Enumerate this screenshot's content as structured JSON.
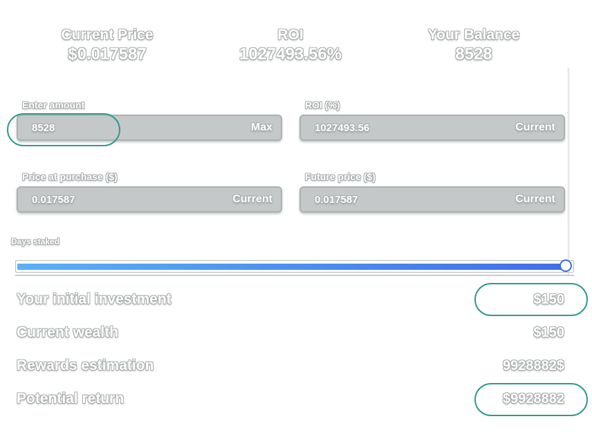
{
  "stats": {
    "current_price": {
      "label": "Current Price",
      "value": "$0.017587"
    },
    "roi": {
      "label": "ROI",
      "value": "1027493.56%"
    },
    "balance": {
      "label": "Your Balance",
      "value": "8528"
    }
  },
  "fields": {
    "amount": {
      "label": "Enter amount",
      "value": "8528",
      "button": "Max"
    },
    "roi": {
      "label": "ROI (%)",
      "value": "1027493.56",
      "button": "Current"
    },
    "purchase_price": {
      "label": "Price at purchase ($)",
      "value": "0.017587",
      "button": "Current"
    },
    "future_price": {
      "label": "Future price ($)",
      "value": "0.017587",
      "button": "Current"
    }
  },
  "slider": {
    "label": "Days staked",
    "fraction": 1.0
  },
  "summary": [
    {
      "label": "Your initial investment",
      "value": "$150"
    },
    {
      "label": "Current wealth",
      "value": "$150"
    },
    {
      "label": "Rewards estimation",
      "value": "9928882$"
    },
    {
      "label": "Potential return",
      "value": "$9928882"
    }
  ],
  "colors": {
    "highlight_oval": "#2e9a8c",
    "slider_gradient_start": "#5bb0f6",
    "slider_gradient_end": "#3f6ee8",
    "input_box_fill": "#c5c8c8"
  }
}
